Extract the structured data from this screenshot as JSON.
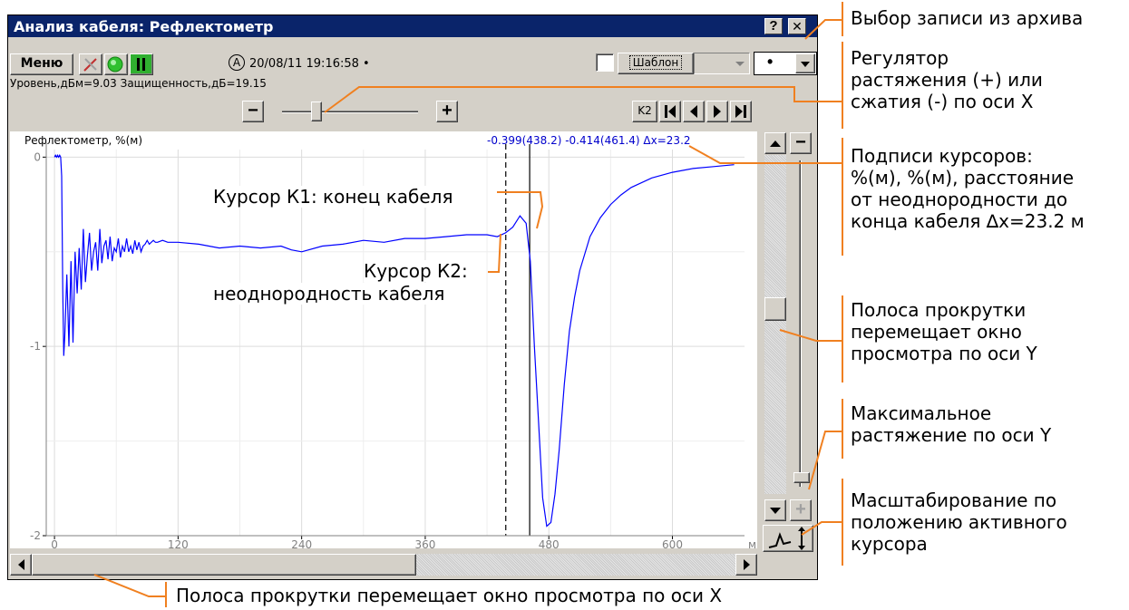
{
  "window": {
    "title": "Анализ кабеля: Рефлектометр",
    "help_label": "?",
    "close_label": "✕"
  },
  "toolbar": {
    "menu_label": "Меню",
    "mode_mark": "А",
    "timestamp": "20/08/11 19:16:58 •",
    "template_label": "Шаблон",
    "record_value": "•",
    "cursor_button_label": "K2",
    "status_line": "Уровень,дБм=9.03  Защищенность,дБ=19.15",
    "zoom_minus": "−",
    "zoom_plus": "+",
    "zoom_level": 0.25
  },
  "plot": {
    "title": "Рефлектометр, %(м)",
    "cursor_readout": "-0.399(438.2)  -0.414(461.4)  Δx=23.2",
    "y_ticks": [
      "0",
      "-1",
      "-2"
    ],
    "x_ticks": [
      "0",
      "120",
      "240",
      "360",
      "480",
      "600"
    ],
    "x_unit": "м",
    "overlay_k1": "Курсор К1: конец кабеля",
    "overlay_k2": [
      "Курсор К2:",
      "неоднородность кабеля"
    ],
    "cursors": {
      "k1": 438.2,
      "k2": 461.4
    },
    "colors": {
      "trace": "#0000ff",
      "readout": "#0000cc",
      "grid": "#dcdcdc",
      "cursor": "#000000"
    }
  },
  "chart_data": {
    "type": "line",
    "title": "Рефлектометр, %(м)",
    "xlabel": "м",
    "ylabel": "",
    "xlim": [
      -8,
      670
    ],
    "ylim": [
      -2,
      0.04
    ],
    "grid": true,
    "series": [
      {
        "x": [
          0,
          1,
          2,
          3,
          4,
          5,
          6,
          7,
          8,
          9,
          10,
          12,
          14,
          16,
          18,
          20,
          22,
          24,
          26,
          28,
          30,
          32,
          34,
          36,
          38,
          40,
          42,
          44,
          46,
          48,
          50,
          52,
          54,
          56,
          58,
          60,
          62,
          64,
          66,
          68,
          70,
          72,
          74,
          76,
          78,
          80,
          82,
          84,
          86,
          88,
          90,
          92,
          94,
          96,
          98,
          100,
          105,
          110,
          120,
          140,
          160,
          180,
          200,
          220,
          230,
          240,
          260,
          280,
          300,
          320,
          340,
          360,
          380,
          400,
          420,
          430,
          438,
          445,
          452,
          458,
          462,
          466,
          470,
          474,
          478,
          482,
          486,
          490,
          495,
          500,
          505,
          510,
          520,
          530,
          540,
          550,
          560,
          580,
          600,
          620,
          640,
          660
        ],
        "y": [
          0,
          0.01,
          0,
          0.01,
          0,
          0.01,
          0,
          -0.1,
          -0.7,
          -1.05,
          -0.95,
          -0.62,
          -1.0,
          -0.55,
          -0.98,
          -0.5,
          -0.72,
          -0.48,
          -0.7,
          -0.38,
          -0.66,
          -0.52,
          -0.4,
          -0.6,
          -0.5,
          -0.45,
          -0.6,
          -0.38,
          -0.56,
          -0.47,
          -0.44,
          -0.54,
          -0.42,
          -0.55,
          -0.48,
          -0.5,
          -0.43,
          -0.53,
          -0.47,
          -0.5,
          -0.43,
          -0.5,
          -0.47,
          -0.51,
          -0.44,
          -0.49,
          -0.45,
          -0.5,
          -0.47,
          -0.46,
          -0.44,
          -0.46,
          -0.45,
          -0.44,
          -0.45,
          -0.45,
          -0.44,
          -0.45,
          -0.45,
          -0.46,
          -0.48,
          -0.47,
          -0.48,
          -0.47,
          -0.49,
          -0.5,
          -0.47,
          -0.46,
          -0.44,
          -0.45,
          -0.43,
          -0.43,
          -0.42,
          -0.41,
          -0.41,
          -0.42,
          -0.4,
          -0.37,
          -0.31,
          -0.35,
          -0.55,
          -1.0,
          -1.4,
          -1.8,
          -1.95,
          -1.93,
          -1.78,
          -1.55,
          -1.2,
          -0.92,
          -0.74,
          -0.6,
          -0.42,
          -0.32,
          -0.25,
          -0.2,
          -0.16,
          -0.11,
          -0.08,
          -0.06,
          -0.05,
          -0.04
        ]
      }
    ]
  },
  "annotations": [
    "Выбор записи из архива",
    "Регулятор растяжения (+) или сжатия (-) по оси X",
    "Подписи курсоров: %(м), %(м), расстояние от неоднородности до конца кабеля ∆x=23.2 м",
    "Полоса прокрутки перемещает окно просмотра по оси Y",
    "Максимальное растяжение по оси Y",
    "Масштабирование по положению активного курсора"
  ],
  "annotation_lines": [
    [
      "Выбор записи из архива"
    ],
    [
      "Регулятор",
      "растяжения (+) или",
      "сжатия (-) по оси X"
    ],
    [
      "Подписи курсоров:",
      "%(м), %(м), расстояние",
      "от неоднородности до",
      "конца кабеля ∆x=23.2 м"
    ],
    [
      "Полоса прокрутки",
      "перемещает окно",
      "просмотра по оси Y"
    ],
    [
      "Максимальное",
      "растяжение по оси Y"
    ],
    [
      "Масштабирование по",
      "положению активного",
      "курсора"
    ]
  ],
  "bottom_note": "Полоса прокрутки перемещает окно просмотра по оси X",
  "scrollbars": {
    "vertical_position": 0.45,
    "horizontal_position": 0.0
  }
}
